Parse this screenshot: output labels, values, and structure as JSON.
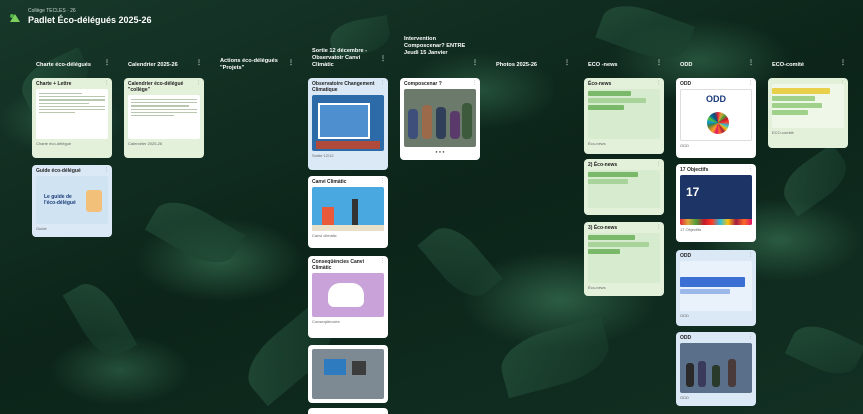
{
  "breadcrumb": "Collège TECLES · 26",
  "board_title": "Padlet Éco-délégués 2025-26",
  "columns": [
    {
      "title": "Charte éco-délégués",
      "menu": "⋮"
    },
    {
      "title": "Calendrier 2025-26",
      "menu": "⋮"
    },
    {
      "title": "Actions éco-délégués \"Projets\"",
      "menu": "⋮"
    },
    {
      "title": "Sortie 12 décembre - Observatoir Canvi Climàtic",
      "menu": "⋮"
    },
    {
      "title": "Intervention Composcenar? ENTRE Jeudi 15 Janvier",
      "menu": "⋮"
    },
    {
      "title": "Photos 2025-26",
      "menu": "⋮"
    },
    {
      "title": "ECO -news",
      "menu": "⋮"
    },
    {
      "title": "ODD",
      "menu": "⋮"
    },
    {
      "title": "ECO-comité",
      "menu": "⋮"
    }
  ],
  "cards": {
    "charte": {
      "title": "Charte + Lettre",
      "foot": "Charte éco-délégué"
    },
    "guide": {
      "title": "Guide éco-délégué",
      "foot": "Guide",
      "thumb_text": "Le guide de l'éco-délégué"
    },
    "calendrier": {
      "title": "Calendrier éco-délégué \"collège\"",
      "foot": "Calendrier 2025-26"
    },
    "observatori": {
      "title": "Observatoire Changement Climatique",
      "foot": "Sortie 12/12"
    },
    "canvi": {
      "title": "Canvi Climàtic",
      "foot": "Canvi climàtic"
    },
    "consequencies": {
      "title": "Conseqüències Canvi Climàtic",
      "foot": "Conseqüències"
    },
    "photo_lab": {
      "title": "",
      "foot": ""
    },
    "composcenar": {
      "title": "Composcenar ?",
      "foot": ""
    },
    "econews1": {
      "title": "Éco-news",
      "foot": "Éco-news"
    },
    "econews2": {
      "title": "2) Éco-news",
      "foot": "Éco-news"
    },
    "econews3": {
      "title": "3) Éco-news",
      "foot": "Éco-news"
    },
    "odd1": {
      "title": "ODD",
      "thumb_text": "ODD",
      "foot": "ODD"
    },
    "odd2": {
      "title": "17 Objectifs",
      "thumb_text": "17",
      "foot": "17 Objectifs"
    },
    "odd3": {
      "title": "ODD",
      "foot": "ODD"
    },
    "odd4": {
      "title": "ODD",
      "foot": "ODD"
    },
    "ecocomite": {
      "title": "",
      "foot": "ECO-comité"
    }
  },
  "colors": {
    "accent_blue": "#3b6fd4",
    "card_green": "#e3f0da",
    "card_blue": "#dbe9f7"
  }
}
